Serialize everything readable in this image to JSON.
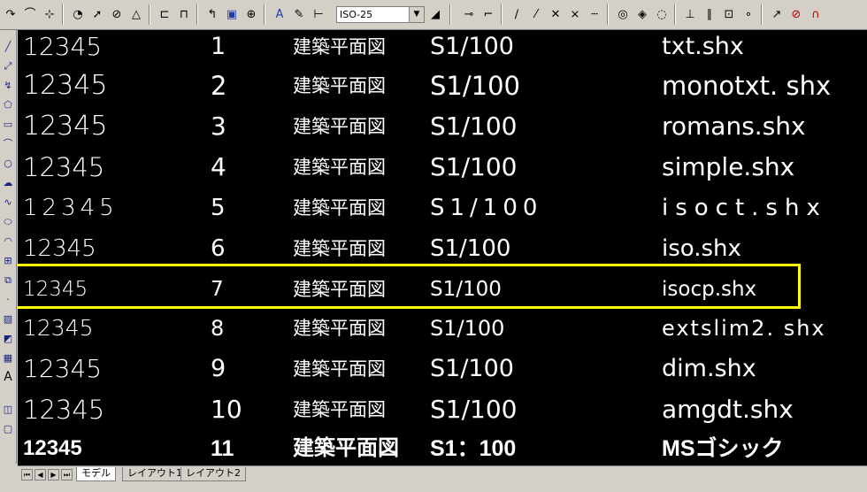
{
  "toolbar": {
    "dim_style_value": "ISO-25"
  },
  "drawing": {
    "rows": [
      {
        "sample": "12345",
        "num": "1",
        "title": "建築平面図",
        "scale": "S1/100",
        "font": "txt.shx",
        "sample_size": "28px",
        "size": "27px"
      },
      {
        "sample": "12345",
        "num": "2",
        "title": "建築平面図",
        "scale": "S1/100",
        "font": "monotxt. shx",
        "sample_size": "30px",
        "size": "29px"
      },
      {
        "sample": "12345",
        "num": "3",
        "title": "建築平面図",
        "scale": "S1/100",
        "font": "romans.shx",
        "sample_size": "30px",
        "size": "28px"
      },
      {
        "sample": "12345",
        "num": "4",
        "title": "建築平面図",
        "scale": "S1/100",
        "font": "simple.shx",
        "sample_size": "29px",
        "size": "28px"
      },
      {
        "sample": "12345",
        "num": "5",
        "title": "建築平面図",
        "scale": "S1/100",
        "font": "isoct.shx",
        "sample_size": "26px",
        "size": "26px"
      },
      {
        "sample": "12345",
        "num": "6",
        "title": "建築平面図",
        "scale": "S1/100",
        "font": "iso.shx",
        "sample_size": "26px",
        "size": "26px"
      },
      {
        "sample": "12345",
        "num": "7",
        "title": "建築平面図",
        "scale": "S1/100",
        "font": "isocp.shx",
        "sample_size": "23px",
        "size": "23px"
      },
      {
        "sample": "12345",
        "num": "8",
        "title": "建築平面図",
        "scale": "S1/100",
        "font": "extslim2. shx",
        "sample_size": "25px",
        "size": "24px"
      },
      {
        "sample": "12345",
        "num": "9",
        "title": "建築平面図",
        "scale": "S1/100",
        "font": "dim.shx",
        "sample_size": "28px",
        "size": "27px"
      },
      {
        "sample": "12345",
        "num": "10",
        "title": "建築平面図",
        "scale": "S1/100",
        "font": "amgdt.shx",
        "sample_size": "29px",
        "size": "28px"
      },
      {
        "sample": "12345",
        "num": "11",
        "title": "建築平面図",
        "scale": "S1：100",
        "font": "MSゴシック",
        "sample_size": "24px",
        "size": "25px"
      }
    ]
  },
  "tabs": [
    "モデル",
    "レイアウト1",
    "レイアウト2"
  ],
  "colors": {
    "canvas": "#000000",
    "highlight": "#ffff00",
    "text": "#ffffff"
  }
}
